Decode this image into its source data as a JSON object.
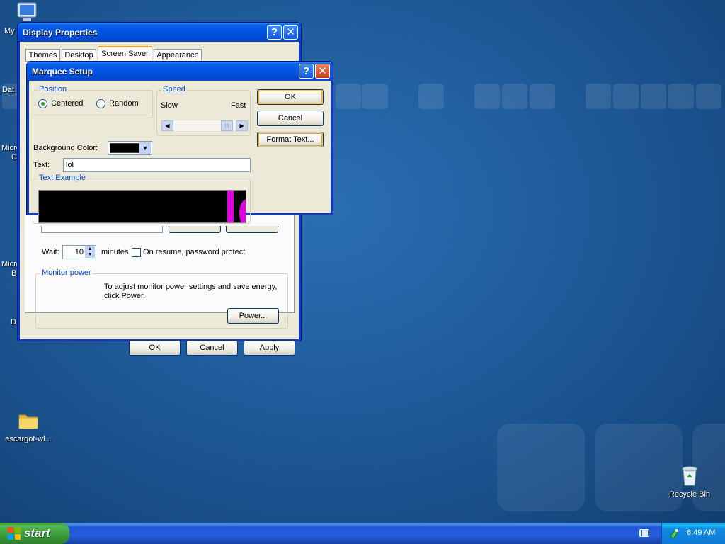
{
  "desktop": {
    "icons": [
      {
        "label": "My",
        "icon": "computer-icon"
      },
      {
        "label": "Dat"
      },
      {
        "label": "Micro"
      },
      {
        "label": "C"
      },
      {
        "label": "Micro"
      },
      {
        "label": "B"
      },
      {
        "label": "D"
      },
      {
        "label": "escargot-wl...",
        "icon": "folder-icon"
      },
      {
        "label": "Recycle Bin",
        "icon": "recycle-bin-icon"
      }
    ]
  },
  "display_properties": {
    "title": "Display Properties",
    "tabs": [
      "Themes",
      "Desktop",
      "Screen Saver",
      "Appearance"
    ],
    "active_tab": "Screen Saver",
    "wait_label": "Wait:",
    "wait_value": "10",
    "minutes_label": "minutes",
    "resume_label": "On resume, password protect",
    "resume_checked": false,
    "monitor_power": {
      "label": "Monitor power",
      "text": "To adjust monitor power settings and save energy, click Power.",
      "button": "Power..."
    },
    "buttons": {
      "ok": "OK",
      "cancel": "Cancel",
      "apply": "Apply"
    }
  },
  "marquee_setup": {
    "title": "Marquee Setup",
    "position": {
      "label": "Position",
      "options": [
        "Centered",
        "Random"
      ],
      "selected": "Centered"
    },
    "speed": {
      "label": "Speed",
      "slow": "Slow",
      "fast": "Fast",
      "value": 0.95
    },
    "background_color_label": "Background Color:",
    "background_color": "#000000",
    "text_label": "Text:",
    "text_value": "lol",
    "example_label": "Text Example",
    "example_text_color": "#e000e0",
    "buttons": {
      "ok": "OK",
      "cancel": "Cancel",
      "format_text": "Format Text..."
    }
  },
  "taskbar": {
    "start_label": "start",
    "clock": "6:49 AM"
  },
  "colors": {
    "xp_blue": "#0054e3",
    "group_label": "#0046d5",
    "dialog_bg": "#ece9d8"
  }
}
